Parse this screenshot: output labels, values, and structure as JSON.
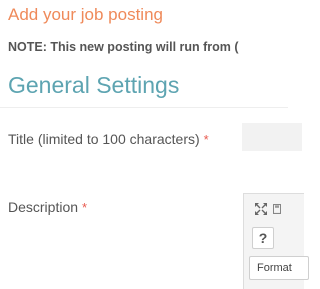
{
  "page": {
    "title": "Add your job posting",
    "note": "NOTE: This new posting will run from ("
  },
  "section": {
    "title": "General Settings"
  },
  "form": {
    "title_label": "Title (limited to 100 characters)",
    "title_value": "",
    "description_label": "Description",
    "required_mark": "*"
  },
  "editor": {
    "toolbar": {
      "fullscreen_icon": "expand-arrows-icon",
      "save_icon": "save-icon",
      "help_label": "?",
      "format_label": "Format"
    }
  },
  "colors": {
    "title_orange": "#ef8a5a",
    "section_teal": "#5da4b1",
    "required_red": "#e8594e"
  }
}
